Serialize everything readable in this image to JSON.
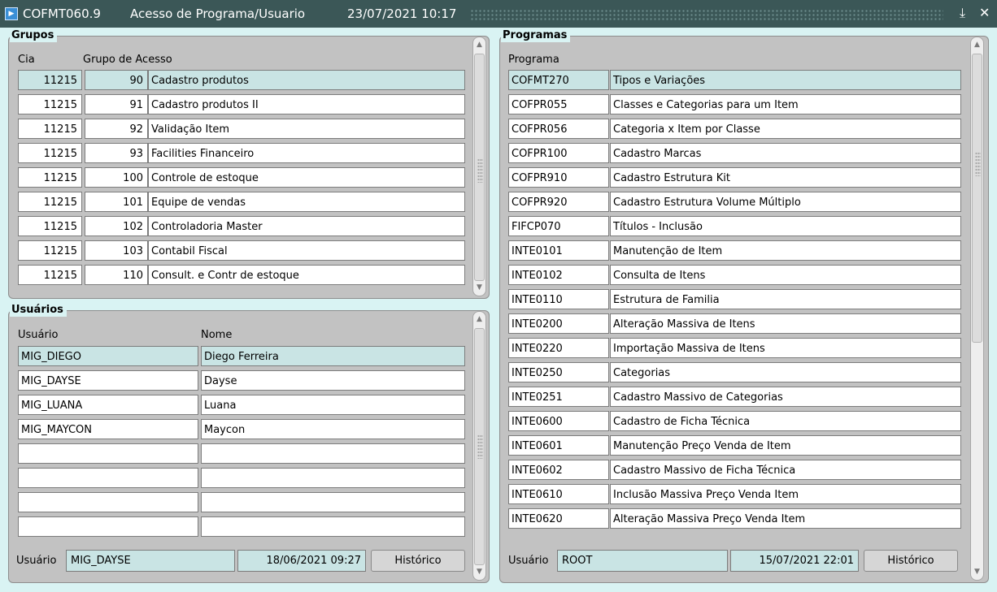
{
  "window": {
    "app_code": "COFMT060.9",
    "title": "Acesso de Programa/Usuario",
    "datetime": "23/07/2021 10:17",
    "minimize_glyph": "⤓",
    "close_glyph": "✕"
  },
  "grupos": {
    "title": "Grupos",
    "col_cia": "Cia",
    "col_grupo": "Grupo de Acesso",
    "rows": [
      {
        "cia": "11215",
        "codigo": "90",
        "nome": "Cadastro produtos"
      },
      {
        "cia": "11215",
        "codigo": "91",
        "nome": "Cadastro produtos II"
      },
      {
        "cia": "11215",
        "codigo": "92",
        "nome": "Validação Item"
      },
      {
        "cia": "11215",
        "codigo": "93",
        "nome": "Facilities Financeiro"
      },
      {
        "cia": "11215",
        "codigo": "100",
        "nome": "Controle de estoque"
      },
      {
        "cia": "11215",
        "codigo": "101",
        "nome": "Equipe de vendas"
      },
      {
        "cia": "11215",
        "codigo": "102",
        "nome": "Controladoria Master"
      },
      {
        "cia": "11215",
        "codigo": "103",
        "nome": "Contabil Fiscal"
      },
      {
        "cia": "11215",
        "codigo": "110",
        "nome": "Consult. e Contr de estoque"
      }
    ]
  },
  "usuarios": {
    "title": "Usuários",
    "col_usuario": "Usuário",
    "col_nome": "Nome",
    "rows": [
      {
        "usuario": "MIG_DIEGO",
        "nome": "Diego Ferreira"
      },
      {
        "usuario": "MIG_DAYSE",
        "nome": "Dayse"
      },
      {
        "usuario": "MIG_LUANA",
        "nome": "Luana"
      },
      {
        "usuario": "MIG_MAYCON",
        "nome": "Maycon"
      },
      {
        "usuario": "",
        "nome": ""
      },
      {
        "usuario": "",
        "nome": ""
      },
      {
        "usuario": "",
        "nome": ""
      },
      {
        "usuario": "",
        "nome": ""
      }
    ],
    "footer": {
      "label": "Usuário",
      "user": "MIG_DAYSE",
      "datetime": "18/06/2021 09:27",
      "button": "Histórico"
    }
  },
  "programas": {
    "title": "Programas",
    "col_programa": "Programa",
    "rows": [
      {
        "codigo": "COFMT270",
        "descricao": "Tipos e Variações"
      },
      {
        "codigo": "COFPR055",
        "descricao": "Classes e Categorias para um Item"
      },
      {
        "codigo": "COFPR056",
        "descricao": "Categoria x Item por Classe"
      },
      {
        "codigo": "COFPR100",
        "descricao": "Cadastro Marcas"
      },
      {
        "codigo": "COFPR910",
        "descricao": "Cadastro Estrutura Kit"
      },
      {
        "codigo": "COFPR920",
        "descricao": "Cadastro Estrutura Volume Múltiplo"
      },
      {
        "codigo": "FIFCP070",
        "descricao": "Títulos - Inclusão"
      },
      {
        "codigo": "INTE0101",
        "descricao": "Manutenção de Item"
      },
      {
        "codigo": "INTE0102",
        "descricao": "Consulta de Itens"
      },
      {
        "codigo": "INTE0110",
        "descricao": "Estrutura de Familia"
      },
      {
        "codigo": "INTE0200",
        "descricao": "Alteração Massiva de Itens"
      },
      {
        "codigo": "INTE0220",
        "descricao": "Importação Massiva de Itens"
      },
      {
        "codigo": "INTE0250",
        "descricao": "Categorias"
      },
      {
        "codigo": "INTE0251",
        "descricao": "Cadastro Massivo de Categorias"
      },
      {
        "codigo": "INTE0600",
        "descricao": "Cadastro de Ficha Técnica"
      },
      {
        "codigo": "INTE0601",
        "descricao": "Manutenção Preço Venda de Item"
      },
      {
        "codigo": "INTE0602",
        "descricao": "Cadastro Massivo de Ficha Técnica"
      },
      {
        "codigo": "INTE0610",
        "descricao": "Inclusão Massiva Preço Venda Item"
      },
      {
        "codigo": "INTE0620",
        "descricao": "Alteração Massiva Preço Venda Item"
      }
    ],
    "footer": {
      "label": "Usuário",
      "user": "ROOT",
      "datetime": "15/07/2021 22:01",
      "button": "Histórico"
    }
  },
  "colors": {
    "titlebar": "#3b5757",
    "background": "#d9f3f3",
    "panel": "#c2c2c2",
    "selected_row": "#c9e4e4"
  }
}
